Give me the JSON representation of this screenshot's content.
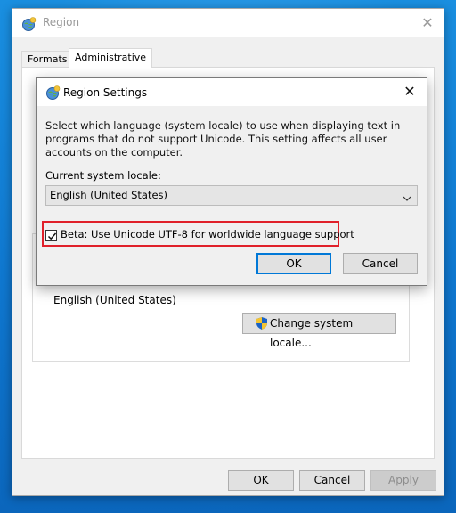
{
  "main_window": {
    "title": "Region",
    "tabs": [
      {
        "label": "Formats"
      },
      {
        "label": "Administrative"
      }
    ],
    "current_locale_value": "English (United States)",
    "change_locale_label": "Change system locale...",
    "footer": {
      "ok_label": "OK",
      "cancel_label": "Cancel",
      "apply_label": "Apply"
    }
  },
  "dialog": {
    "title": "Region Settings",
    "description": "Select which language (system locale) to use when displaying text in programs that do not support Unicode. This setting affects all user accounts on the computer.",
    "locale_label": "Current system locale:",
    "locale_selected": "English (United States)",
    "beta_checkbox": {
      "label": "Beta: Use Unicode UTF-8 for worldwide language support",
      "checked": true
    },
    "ok_label": "OK",
    "cancel_label": "Cancel"
  },
  "colors": {
    "highlight_border": "#e0202a",
    "focus_border": "#0078d7",
    "desktop": "#1283d9"
  },
  "icons": {
    "window": "globe-icon",
    "close": "close-icon",
    "uac": "shield-icon",
    "dropdown": "chevron-down-icon",
    "check": "checkmark-icon"
  }
}
